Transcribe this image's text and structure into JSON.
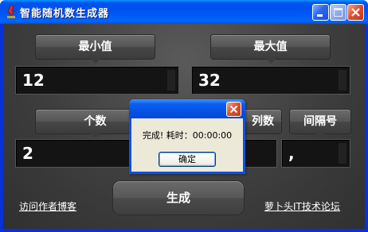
{
  "window": {
    "title": "智能随机数生成器",
    "icon": "app-icon"
  },
  "labels": {
    "min": "最小值",
    "max": "最大值",
    "count": "个数",
    "columns": "列数",
    "separator": "间隔号"
  },
  "fields": {
    "min_value": "12",
    "max_value": "32",
    "count_value": "2",
    "columns_value": "",
    "separator_value": ","
  },
  "buttons": {
    "generate": "生成"
  },
  "links": {
    "visit_blog": "访问作者博客",
    "forum": "萝卜头IT技术论坛"
  },
  "dialog": {
    "message": "完成! 耗时：00:00:00",
    "ok": "确定"
  }
}
